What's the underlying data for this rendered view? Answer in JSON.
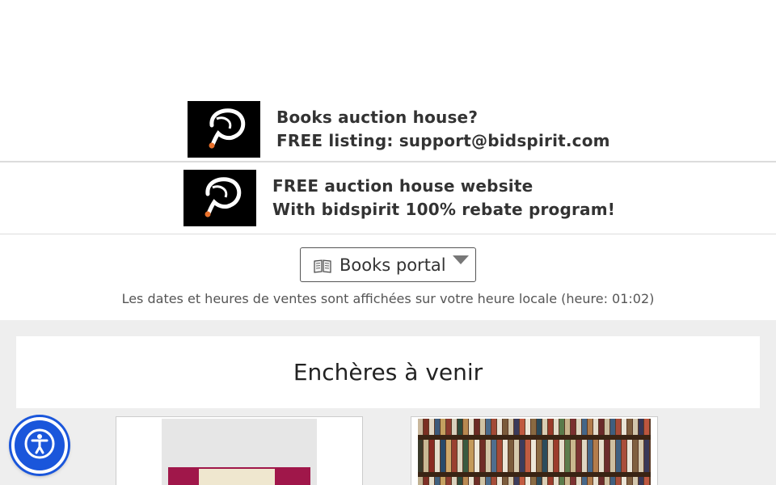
{
  "promos": [
    {
      "line1": "Books auction house?",
      "line2": "FREE listing: support@bidspirit.com"
    },
    {
      "line1": "FREE auction house website",
      "line2": "With bidspirit 100% rebate program!"
    }
  ],
  "portal": {
    "label": "Books portal",
    "icon": "open-book-icon"
  },
  "timezone_note": "Les dates et heures de ventes sont affichées sur votre heure locale (heure: 01:02)",
  "section_title": "Enchères à venir",
  "accessibility": {
    "icon": "accessibility-person-icon",
    "color": "#1a56db"
  }
}
